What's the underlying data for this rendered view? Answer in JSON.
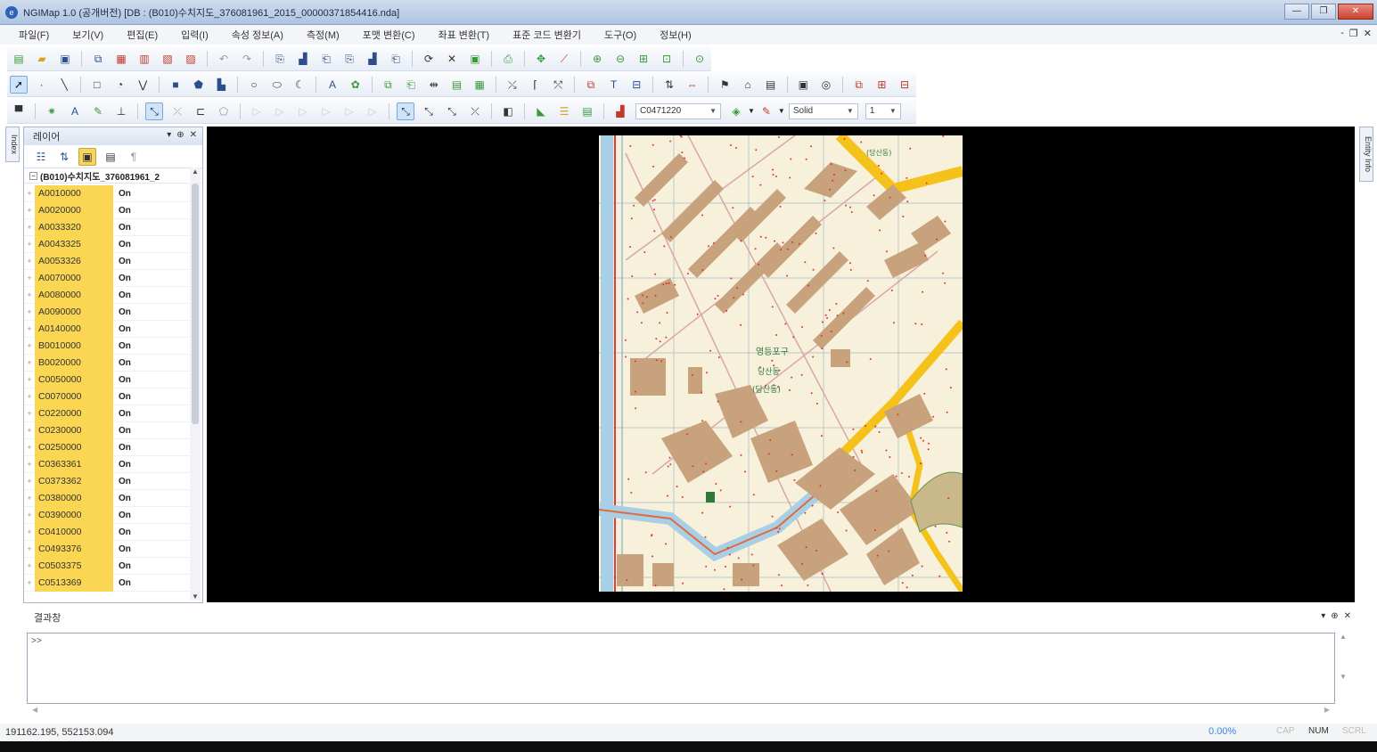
{
  "window": {
    "title": "NGIMap 1.0 (공개버전) [DB : (B010)수치지도_376081961_2015_00000371854416.nda]",
    "controls": [
      "—",
      "❐",
      "✕"
    ]
  },
  "menu": {
    "items": [
      "파일(F)",
      "보기(V)",
      "편집(E)",
      "입력(I)",
      "속성 정보(A)",
      "측정(M)",
      "포맷 변환(C)",
      "좌표 변환(T)",
      "표준 코드 변환기",
      "도구(O)",
      "정보(H)"
    ],
    "mdi_controls": [
      "-",
      "❐",
      "✕"
    ]
  },
  "toolbar": {
    "layer_code_value": "C0471220",
    "line_style_value": "Solid",
    "line_width_value": "1"
  },
  "side_tabs": {
    "left": "Index",
    "right": "Entity Info"
  },
  "layer_panel": {
    "title": "레이어",
    "controls": [
      "▾",
      "⊕",
      "✕"
    ],
    "root_label": "(B010)수치지도_376081961_2",
    "layers": [
      {
        "name": "A0010000",
        "status": "On"
      },
      {
        "name": "A0020000",
        "status": "On"
      },
      {
        "name": "A0033320",
        "status": "On"
      },
      {
        "name": "A0043325",
        "status": "On"
      },
      {
        "name": "A0053326",
        "status": "On"
      },
      {
        "name": "A0070000",
        "status": "On"
      },
      {
        "name": "A0080000",
        "status": "On"
      },
      {
        "name": "A0090000",
        "status": "On"
      },
      {
        "name": "A0140000",
        "status": "On"
      },
      {
        "name": "B0010000",
        "status": "On"
      },
      {
        "name": "B0020000",
        "status": "On"
      },
      {
        "name": "C0050000",
        "status": "On"
      },
      {
        "name": "C0070000",
        "status": "On"
      },
      {
        "name": "C0220000",
        "status": "On"
      },
      {
        "name": "C0230000",
        "status": "On"
      },
      {
        "name": "C0250000",
        "status": "On"
      },
      {
        "name": "C0363361",
        "status": "On"
      },
      {
        "name": "C0373362",
        "status": "On"
      },
      {
        "name": "C0380000",
        "status": "On"
      },
      {
        "name": "C0390000",
        "status": "On"
      },
      {
        "name": "C0410000",
        "status": "On"
      },
      {
        "name": "C0493376",
        "status": "On"
      },
      {
        "name": "C0503375",
        "status": "On"
      },
      {
        "name": "C0513369",
        "status": "On"
      }
    ]
  },
  "map": {
    "labels": [
      "영등포구",
      "당산동",
      "(당산동)",
      "(당산동)"
    ]
  },
  "result_panel": {
    "title": "결과창",
    "controls": [
      "▾",
      "⊕",
      "✕"
    ],
    "prompt": ">>"
  },
  "status": {
    "coordinates": "191162.195, 552153.094",
    "progress": "0.00%",
    "cap": "CAP",
    "num": "NUM",
    "scrl": "SCRL"
  },
  "colors": {
    "layer_highlight": "#fbd653",
    "map_background": "#000000",
    "building_fill": "#c8a27c",
    "road_major": "#f4c21a"
  }
}
